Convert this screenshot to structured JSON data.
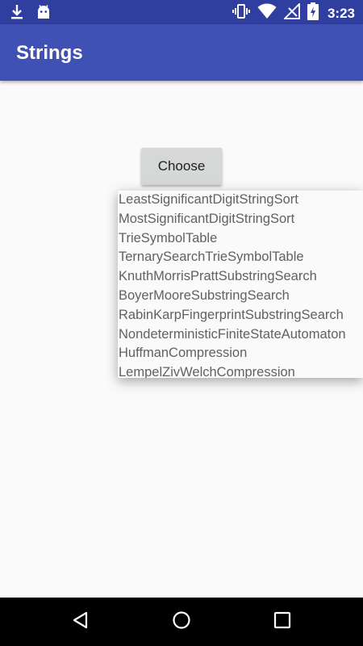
{
  "status_bar": {
    "time": "3:23",
    "icons": [
      "download-icon",
      "android-icon",
      "vibrate-icon",
      "wifi-icon",
      "no-signal-icon",
      "battery-charging-icon"
    ],
    "color": "#303f9f"
  },
  "app_bar": {
    "title": "Strings",
    "color": "#3f51b5"
  },
  "main": {
    "choose_label": "Choose"
  },
  "popup": {
    "items": [
      "LeastSignificantDigitStringSort",
      "MostSignificantDigitStringSort",
      "TrieSymbolTable",
      "TernarySearchTrieSymbolTable",
      "KnuthMorrisPrattSubstringSearch",
      "BoyerMooreSubstringSearch",
      "RabinKarpFingerprintSubstringSearch",
      "NondeterministicFiniteStateAutomaton",
      "HuffmanCompression",
      "LempelZivWelchCompression"
    ]
  },
  "nav_bar": {
    "buttons": [
      "back-icon",
      "home-icon",
      "recents-icon"
    ]
  }
}
